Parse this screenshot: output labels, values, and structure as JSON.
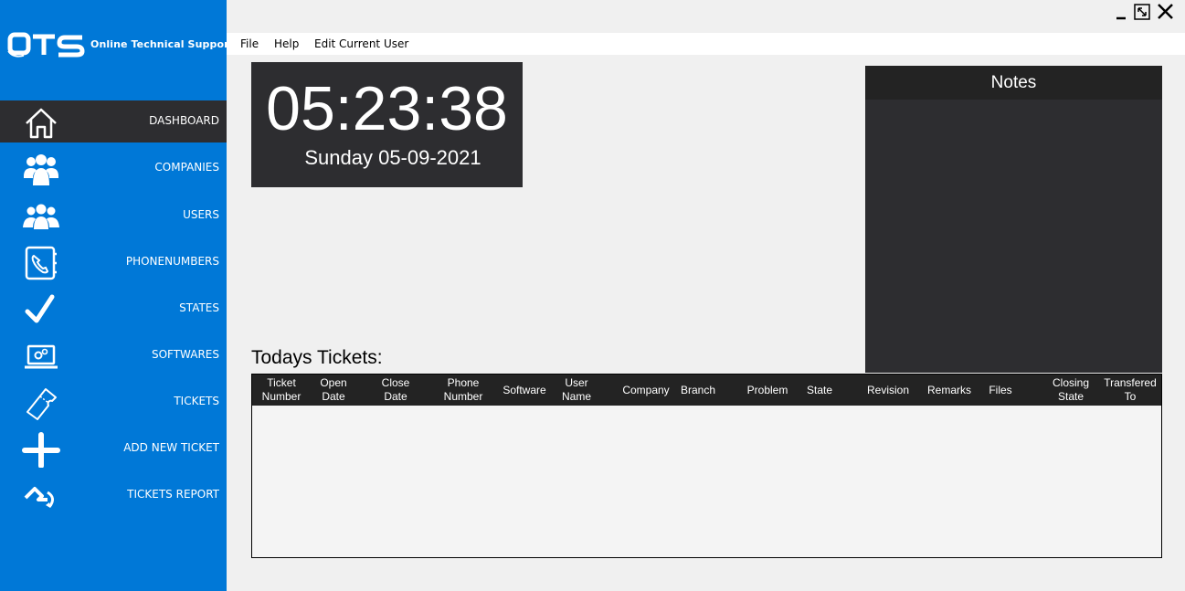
{
  "app": {
    "logo_mark": "OTS",
    "logo_text": "Online Technical Support"
  },
  "window_controls": {
    "minimize_icon": "minimize-icon",
    "restore_icon": "restore-icon",
    "close_icon": "close-icon"
  },
  "menu": {
    "file": "File",
    "help": "Help",
    "edit_current_user": "Edit Current User"
  },
  "sidebar": {
    "items": [
      {
        "label": "DASHBOARD",
        "icon": "home-icon",
        "active": true
      },
      {
        "label": "COMPANIES",
        "icon": "group-icon",
        "active": false
      },
      {
        "label": "USERS",
        "icon": "users-icon",
        "active": false
      },
      {
        "label": "PHONENUMBERS",
        "icon": "phonebook-icon",
        "active": false
      },
      {
        "label": "STATES",
        "icon": "checkmark-icon",
        "active": false
      },
      {
        "label": "SOFTWARES",
        "icon": "laptop-icon",
        "active": false
      },
      {
        "label": "TICKETS",
        "icon": "ticket-icon",
        "active": false
      },
      {
        "label": "ADD NEW TICKET",
        "icon": "plus-icon",
        "active": false
      },
      {
        "label": "TICKETS REPORT",
        "icon": "ticket-report-icon",
        "active": false
      }
    ]
  },
  "clock": {
    "time": "05:23:38",
    "date": "Sunday 05-09-2021"
  },
  "notes": {
    "title": "Notes"
  },
  "tickets": {
    "title": "Todays Tickets:",
    "columns": [
      "Ticket\nNumber",
      "Open\nDate",
      "Close\nDate",
      "Phone\nNumber",
      "Software",
      "User\nName",
      "Company",
      "Branch",
      "Problem",
      "State",
      "Revision",
      "Remarks",
      "Files",
      "Closing\nState",
      "Transfered\nTo"
    ],
    "rows": []
  },
  "colors": {
    "sidebar": "#0078d7",
    "dark_panel": "#2d2d30",
    "header_dark": "#232323",
    "background": "#f0f0f0"
  }
}
